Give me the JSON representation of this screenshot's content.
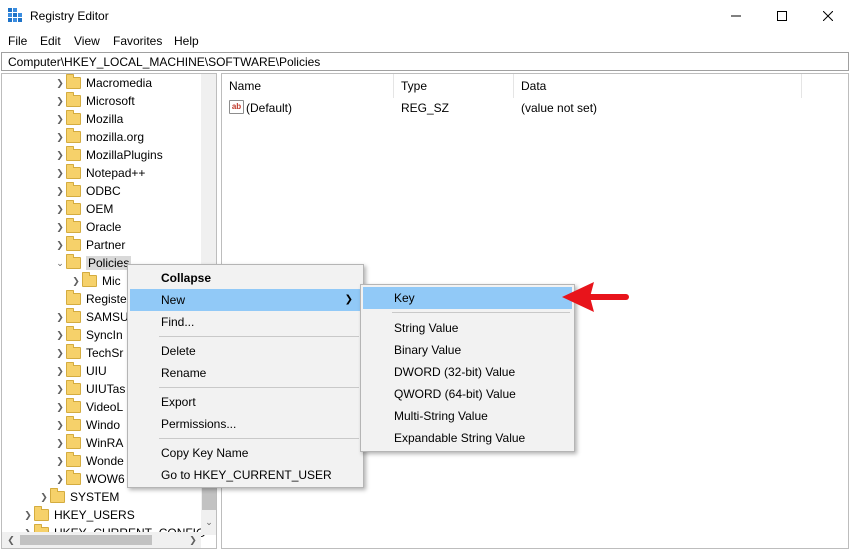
{
  "window": {
    "title": "Registry Editor",
    "minimize_icon": "minimize-icon",
    "maximize_icon": "maximize-icon",
    "close_icon": "close-icon"
  },
  "menubar": {
    "items": [
      {
        "label": "File"
      },
      {
        "label": "Edit"
      },
      {
        "label": "View"
      },
      {
        "label": "Favorites"
      },
      {
        "label": "Help"
      }
    ]
  },
  "address": {
    "path": "Computer\\HKEY_LOCAL_MACHINE\\SOFTWARE\\Policies"
  },
  "tree": {
    "items": [
      {
        "label": "Macromedia",
        "expander": "collapsed"
      },
      {
        "label": "Microsoft",
        "expander": "collapsed"
      },
      {
        "label": "Mozilla",
        "expander": "collapsed"
      },
      {
        "label": "mozilla.org",
        "expander": "collapsed"
      },
      {
        "label": "MozillaPlugins",
        "expander": "collapsed"
      },
      {
        "label": "Notepad++",
        "expander": "collapsed"
      },
      {
        "label": "ODBC",
        "expander": "collapsed"
      },
      {
        "label": "OEM",
        "expander": "collapsed"
      },
      {
        "label": "Oracle",
        "expander": "collapsed"
      },
      {
        "label": "Partner",
        "expander": "collapsed"
      },
      {
        "label": "Policies",
        "expander": "expanded",
        "selected": true
      },
      {
        "label": "Mic",
        "expander": "collapsed"
      },
      {
        "label": "Registe",
        "expander": "none"
      },
      {
        "label": "SAMSU",
        "expander": "collapsed"
      },
      {
        "label": "SyncIn",
        "expander": "collapsed"
      },
      {
        "label": "TechSr",
        "expander": "collapsed"
      },
      {
        "label": "UIU",
        "expander": "collapsed"
      },
      {
        "label": "UIUTas",
        "expander": "collapsed"
      },
      {
        "label": "VideoL",
        "expander": "collapsed"
      },
      {
        "label": "Windo",
        "expander": "collapsed"
      },
      {
        "label": "WinRA",
        "expander": "collapsed"
      },
      {
        "label": "Wonde",
        "expander": "collapsed"
      },
      {
        "label": "WOW6",
        "expander": "collapsed"
      },
      {
        "label": "SYSTEM",
        "expander": "collapsed"
      },
      {
        "label": "HKEY_USERS",
        "expander": "collapsed"
      },
      {
        "label": "HKEY_CURRENT_CONFIG",
        "expander": "collapsed"
      }
    ]
  },
  "list": {
    "columns": [
      "Name",
      "Type",
      "Data"
    ],
    "rows": [
      {
        "name": "(Default)",
        "type": "REG_SZ",
        "data": "(value not set)",
        "icon": "ab"
      }
    ]
  },
  "context_menu": {
    "items": [
      {
        "label": "Collapse",
        "bold": true
      },
      {
        "label": "New",
        "highlighted": true,
        "has_submenu": true
      },
      {
        "label": "Find..."
      },
      {
        "label": "Delete"
      },
      {
        "label": "Rename"
      },
      {
        "label": "Export"
      },
      {
        "label": "Permissions..."
      },
      {
        "label": "Copy Key Name"
      },
      {
        "label": "Go to HKEY_CURRENT_USER"
      }
    ]
  },
  "submenu": {
    "items": [
      {
        "label": "Key",
        "highlighted": true
      },
      {
        "label": "String Value"
      },
      {
        "label": "Binary Value"
      },
      {
        "label": "DWORD (32-bit) Value"
      },
      {
        "label": "QWORD (64-bit) Value"
      },
      {
        "label": "Multi-String Value"
      },
      {
        "label": "Expandable String Value"
      }
    ]
  },
  "colors": {
    "highlight": "#91c9f7",
    "menu_bg": "#f2f2f2",
    "folder": "#f6d16a",
    "annotation_arrow": "#e8141b"
  },
  "annotation": {
    "icon": "red-arrow-icon",
    "points_to": "Key"
  }
}
